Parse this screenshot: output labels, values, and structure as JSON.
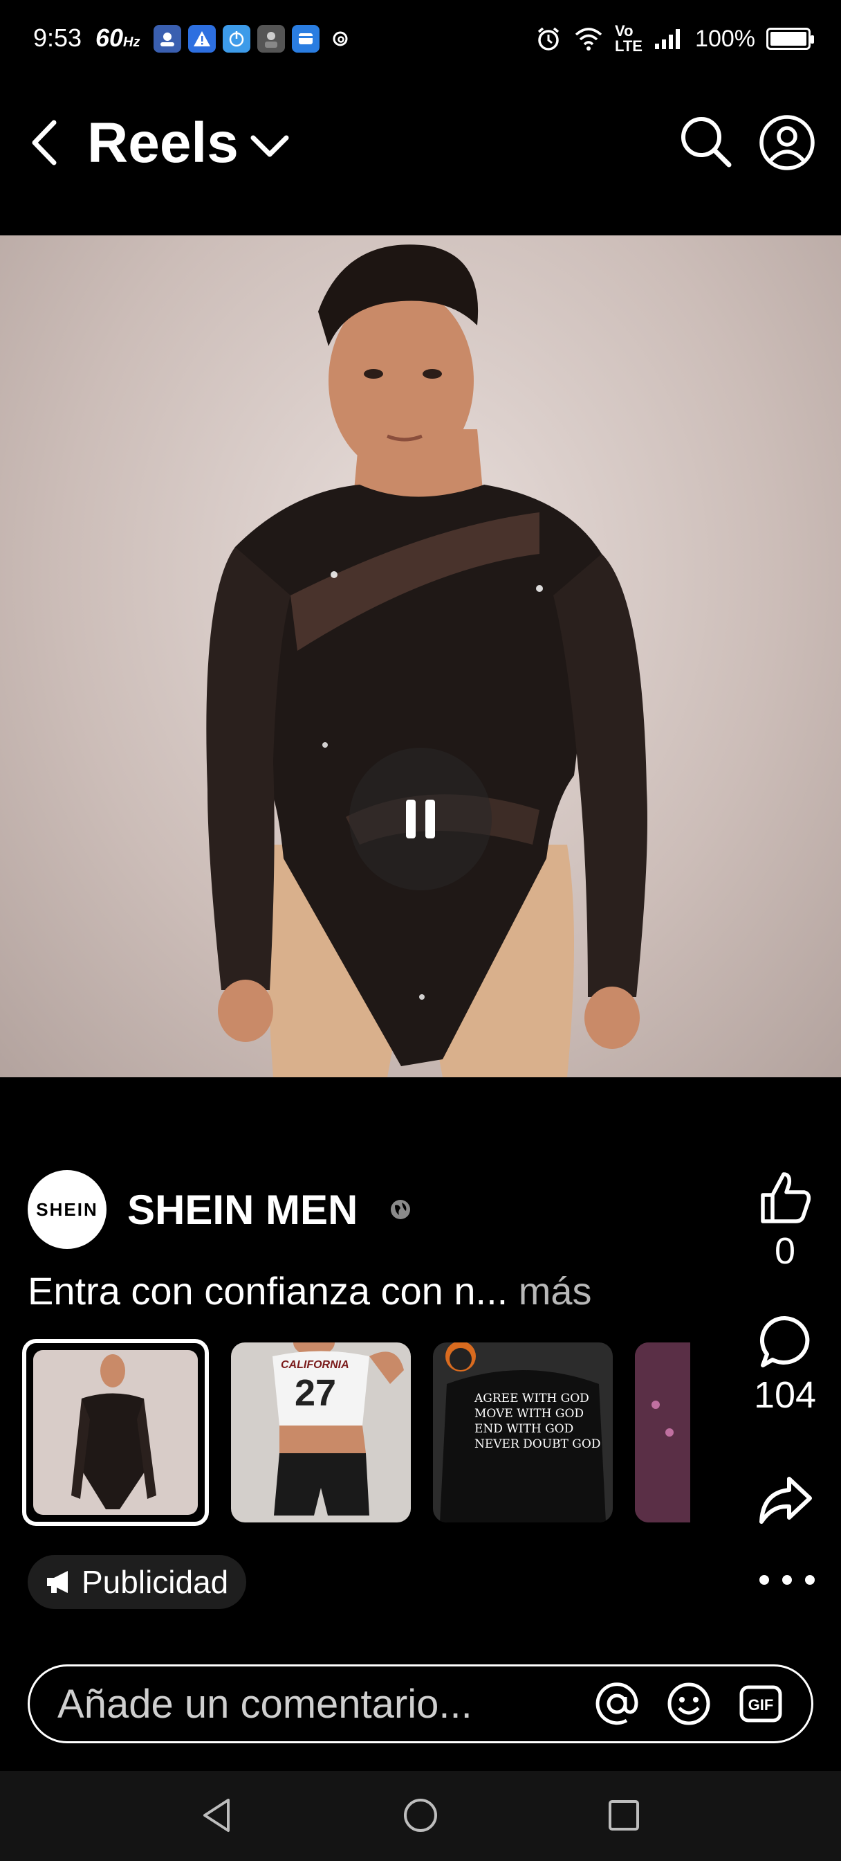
{
  "status_bar": {
    "time": "9:53",
    "refresh_rate": "60",
    "refresh_unit": "Hz",
    "battery": "100%",
    "network": "Vo LTE"
  },
  "header": {
    "title": "Reels"
  },
  "post": {
    "author_name": "SHEIN MEN",
    "avatar_text": "SHEIN",
    "caption": "Entra con confianza con n...",
    "more_label": "más",
    "ad_label": "Publicidad",
    "hoodie_print": "AGREE WITH GOD\nMOVE WITH GOD\nEND WITH GOD\nNEVER DOUBT GOD",
    "jersey_text": "CALIFORNIA",
    "jersey_number": "27"
  },
  "actions": {
    "likes": "0",
    "comments": "104"
  },
  "comment_box": {
    "placeholder": "Añade un comentario..."
  },
  "icons": {
    "back": "back-arrow-icon",
    "chevron": "chevron-down-icon",
    "search": "search-icon",
    "profile": "profile-icon",
    "pause": "pause-icon",
    "like": "thumbs-up-icon",
    "comment": "comment-icon",
    "share": "share-icon",
    "megaphone": "megaphone-icon",
    "mention": "at-icon",
    "emoji": "emoji-icon",
    "gif": "gif-icon"
  },
  "colors": {
    "background": "#000000",
    "text": "#ffffff",
    "muted": "#b8b8b8",
    "ad_badge": "#1e1e1e"
  }
}
